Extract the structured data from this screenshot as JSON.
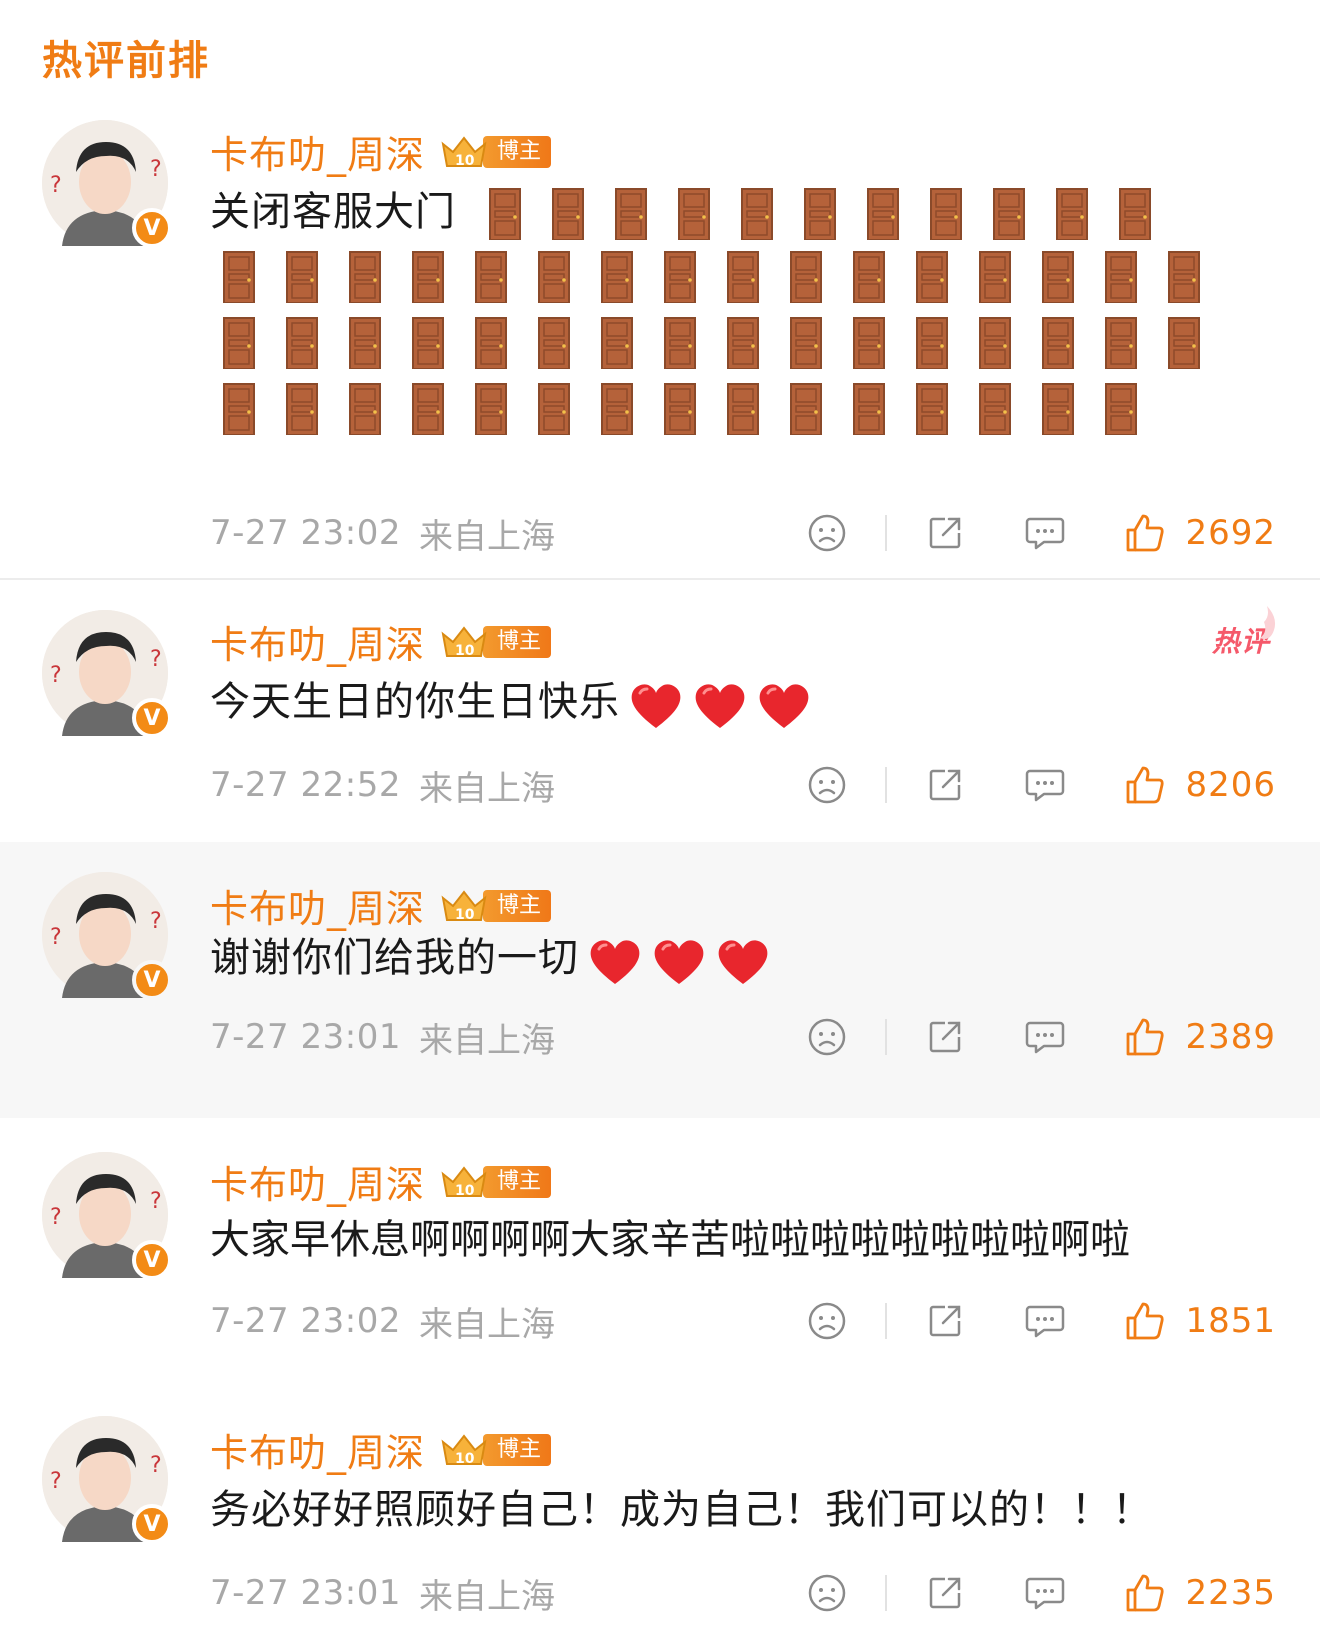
{
  "section": {
    "title": "热评前排"
  },
  "colors": {
    "accent": "#f07c14",
    "meta": "#a8a8a8",
    "heart": "#e8262d",
    "door": "#b5623a"
  },
  "comments": [
    {
      "username": "卡布叻_周深",
      "badge": "博主",
      "text": "关闭客服大门",
      "emoji": "door-icon",
      "emoji_count": 58,
      "time": "7-27 23:02",
      "location": "来自上海",
      "likes": "2692",
      "hot": false
    },
    {
      "username": "卡布叻_周深",
      "badge": "博主",
      "text": "今天生日的你生日快乐",
      "emoji": "heart-icon",
      "emoji_count": 3,
      "time": "7-27 22:52",
      "location": "来自上海",
      "likes": "8206",
      "hot": true,
      "hot_label": "热评"
    },
    {
      "username": "卡布叻_周深",
      "badge": "博主",
      "text": "谢谢你们给我的一切",
      "emoji": "heart-icon",
      "emoji_count": 3,
      "time": "7-27 23:01",
      "location": "来自上海",
      "likes": "2389",
      "hot": false
    },
    {
      "username": "卡布叻_周深",
      "badge": "博主",
      "text": "大家早休息啊啊啊啊大家辛苦啦啦啦啦啦啦啦啦啊啦",
      "time": "7-27 23:02",
      "location": "来自上海",
      "likes": "1851",
      "hot": false
    },
    {
      "username": "卡布叻_周深",
      "badge": "博主",
      "text": "务必好好照顾好自己！成为自己！我们可以的！！！",
      "time": "7-27 23:01",
      "location": "来自上海",
      "likes": "2235",
      "hot": false
    }
  ],
  "icons": {
    "dislike": "frown-face-icon",
    "share": "share-icon",
    "reply": "comment-bubble-icon",
    "like": "thumbs-up-icon",
    "verified": "verified-v-icon",
    "crown": "crown-level-icon"
  }
}
